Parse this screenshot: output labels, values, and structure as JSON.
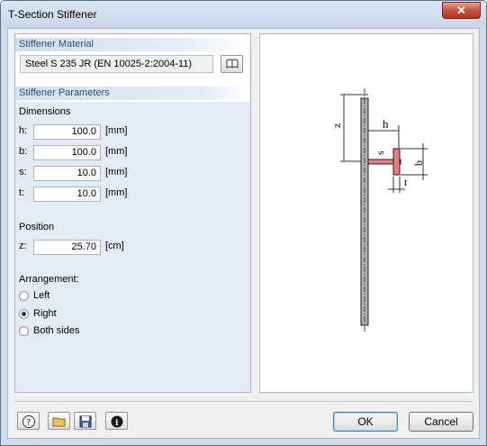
{
  "window": {
    "title": "T-Section Stiffener",
    "close_glyph": "✕"
  },
  "material": {
    "header": "Stiffener Material",
    "value": "Steel S 235 JR (EN 10025-2:2004-11)",
    "library_icon": "book-icon"
  },
  "parameters": {
    "header": "Stiffener Parameters",
    "dimensions_label": "Dimensions",
    "fields": [
      {
        "label": "h:",
        "value": "100.0",
        "unit": "[mm]"
      },
      {
        "label": "b:",
        "value": "100.0",
        "unit": "[mm]"
      },
      {
        "label": "s:",
        "value": "10.0",
        "unit": "[mm]"
      },
      {
        "label": "t:",
        "value": "10.0",
        "unit": "[mm]"
      }
    ],
    "position_label": "Position",
    "position": {
      "label": "z:",
      "value": "25.70",
      "unit": "[cm]"
    },
    "arrangement_label": "Arrangement:",
    "arrangement_options": [
      "Left",
      "Right",
      "Both sides"
    ],
    "arrangement_selected": "Right"
  },
  "preview": {
    "labels": {
      "z": "z",
      "h": "h",
      "s": "s",
      "b": "b",
      "t": "t"
    },
    "stiffener_color": "#f07a7a"
  },
  "toolbar": {
    "icons": [
      "help-icon",
      "open-folder-icon",
      "save-icon",
      "info-icon"
    ]
  },
  "buttons": {
    "ok": "OK",
    "cancel": "Cancel"
  }
}
